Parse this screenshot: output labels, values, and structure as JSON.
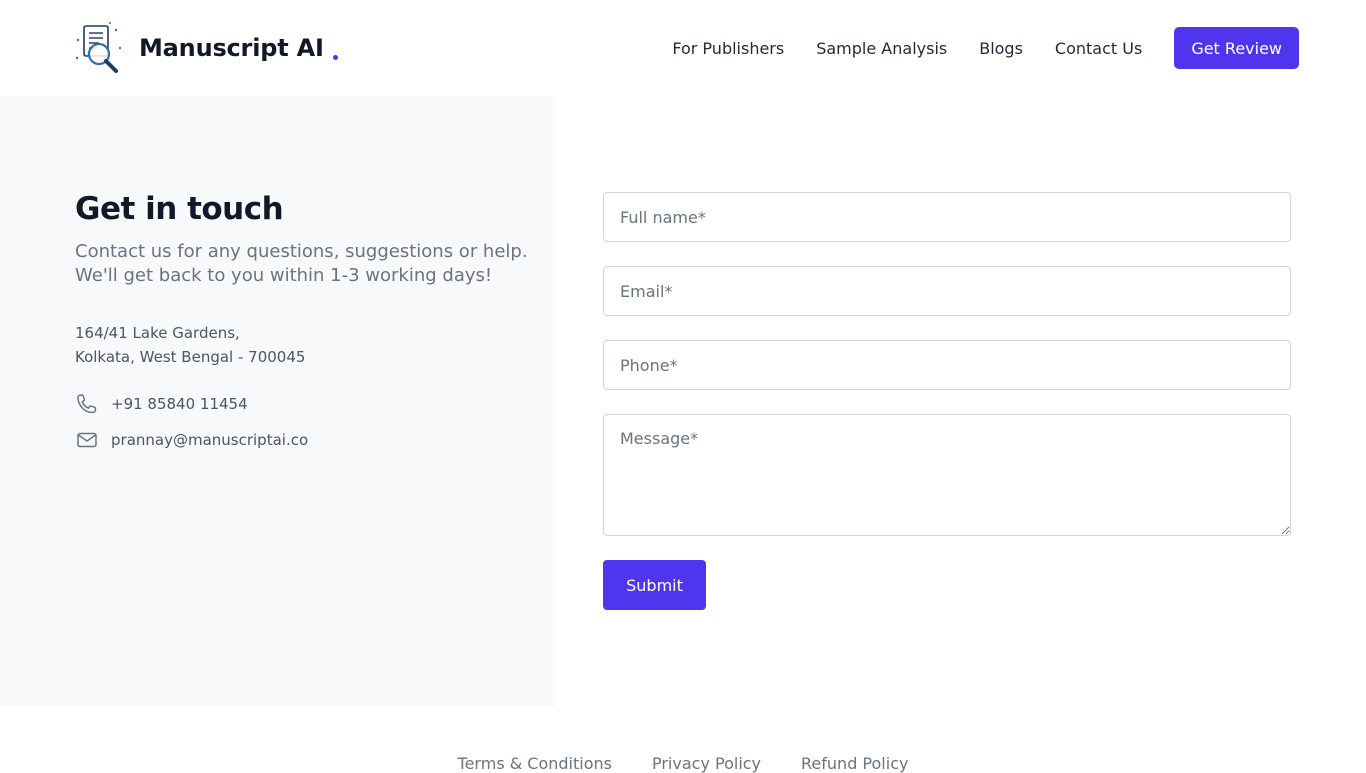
{
  "header": {
    "logo_text": "Manuscript AI",
    "nav": [
      {
        "label": "For Publishers"
      },
      {
        "label": "Sample Analysis"
      },
      {
        "label": "Blogs"
      },
      {
        "label": "Contact Us"
      }
    ],
    "cta_label": "Get Review"
  },
  "contact": {
    "heading": "Get in touch",
    "subtext_line1": "Contact us for any questions, suggestions or help.",
    "subtext_line2": "We'll get back to you within 1-3 working days!",
    "address_line1": "164/41 Lake Gardens,",
    "address_line2": "Kolkata, West Bengal - 700045",
    "phone": "+91 85840 11454",
    "email": "prannay@manuscriptai.co",
    "phone_icon": "phone-icon",
    "email_icon": "mail-icon"
  },
  "form": {
    "full_name": {
      "placeholder": "Full name*",
      "value": ""
    },
    "email": {
      "placeholder": "Email*",
      "value": ""
    },
    "phone": {
      "placeholder": "Phone*",
      "value": ""
    },
    "message": {
      "placeholder": "Message*",
      "value": ""
    },
    "submit_label": "Submit"
  },
  "footer": {
    "links": [
      {
        "label": "Terms & Conditions"
      },
      {
        "label": "Privacy Policy"
      },
      {
        "label": "Refund Policy"
      }
    ]
  },
  "colors": {
    "accent": "#4f35ee",
    "panel_bg": "#f8f9fb",
    "muted_text": "#6b7280"
  }
}
